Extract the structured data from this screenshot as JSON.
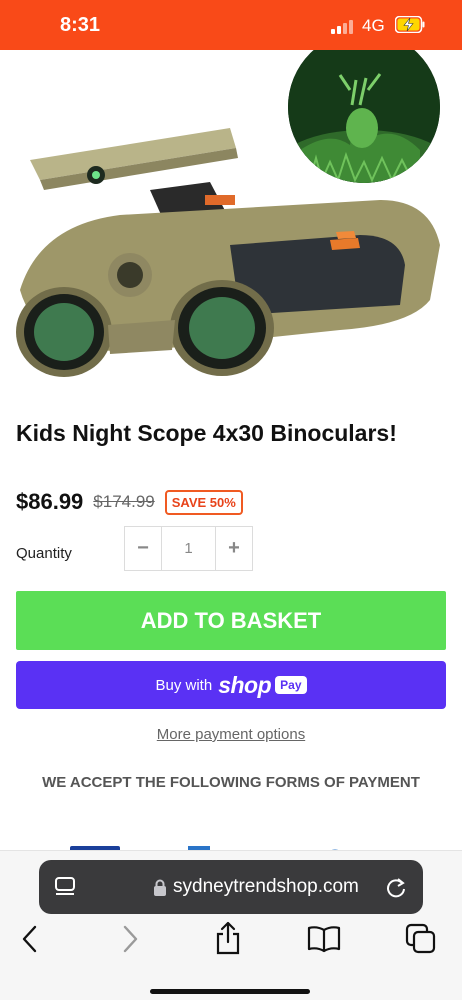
{
  "status_bar": {
    "time": "8:31",
    "network": "4G",
    "battery_charging": true,
    "background_color": "#f94a18"
  },
  "product": {
    "image": "kids-night-scope-binoculars-photo",
    "title": "Kids Night Scope 4x30 Binoculars!",
    "price": "$86.99",
    "compare_price": "$174.99",
    "save_badge": "SAVE 50%"
  },
  "quantity": {
    "label": "Quantity",
    "minus": "−",
    "value": "1",
    "plus": "+"
  },
  "buttons": {
    "add_to_basket": "ADD TO BASKET",
    "shop_pay_prefix": "Buy with",
    "shop_pay_logo": "shop",
    "shop_pay_badge": "Pay",
    "more_payment_options": "More payment options",
    "add_to_basket_color": "#5bde56",
    "shop_pay_color": "#5a31f4"
  },
  "payment": {
    "heading": "WE ACCEPT THE FOLLOWING FORMS OF PAYMENT",
    "icons": [
      "visa-icon",
      "mastercard-icon",
      "amex-icon",
      "diners-icon"
    ]
  },
  "browser": {
    "url": "sydneytrendshop.com",
    "icons": [
      "reader-icon",
      "lock-icon",
      "reload-icon",
      "back-icon",
      "forward-icon",
      "share-icon",
      "bookmarks-icon",
      "tabs-icon"
    ]
  }
}
